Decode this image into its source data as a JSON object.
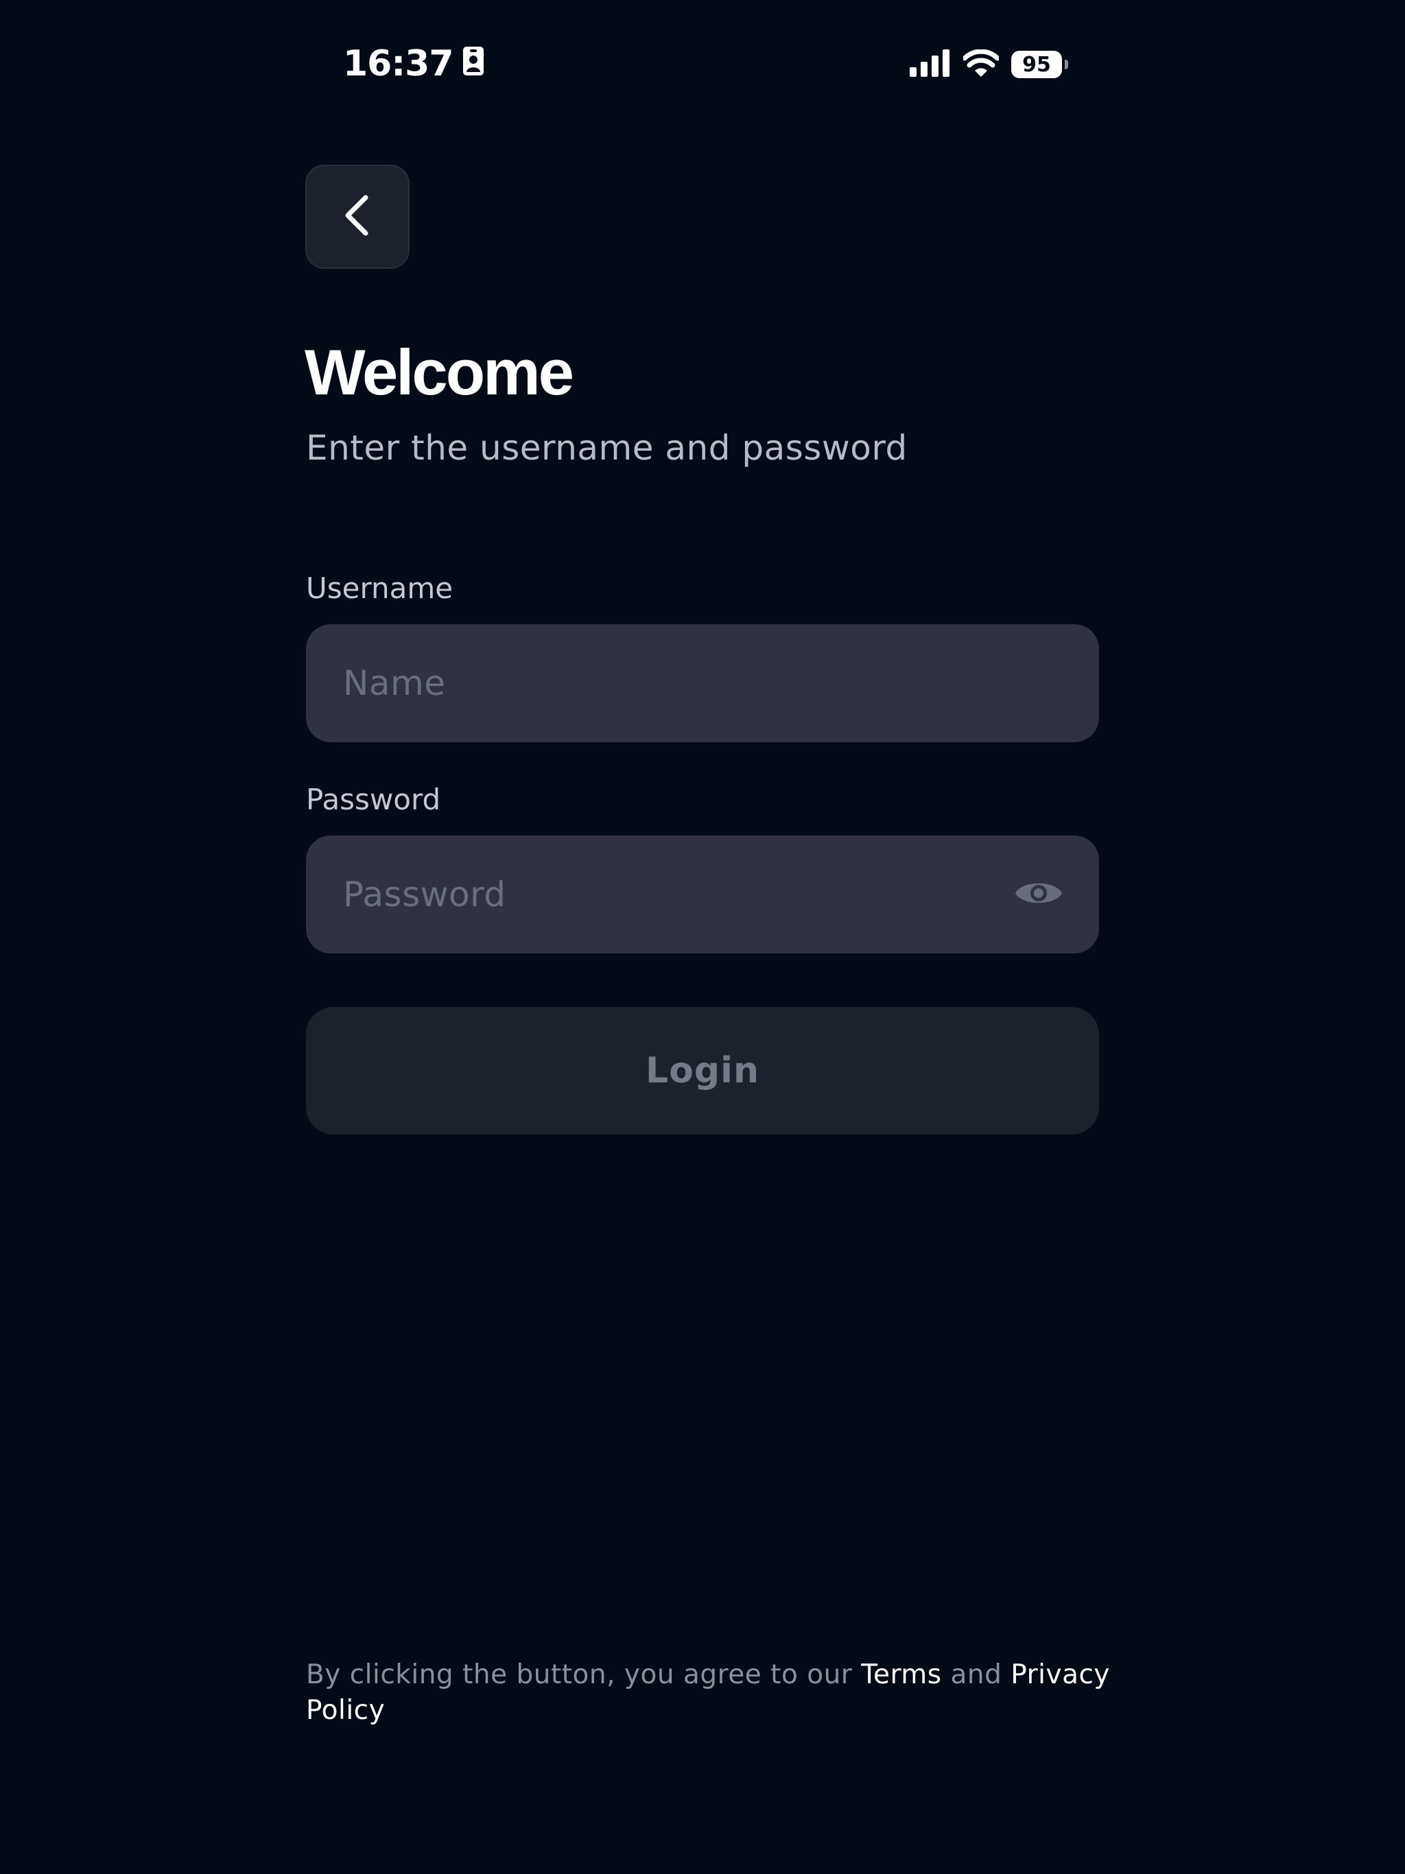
{
  "status_bar": {
    "time": "16:37",
    "battery": "95"
  },
  "header": {
    "title": "Welcome",
    "subtitle": "Enter the username and password"
  },
  "form": {
    "username_label": "Username",
    "username_placeholder": "Name",
    "username_value": "",
    "password_label": "Password",
    "password_placeholder": "Password",
    "password_value": "",
    "login_label": "Login"
  },
  "legal": {
    "prefix": "By clicking the button, you agree to our ",
    "terms": "Terms",
    "conjunction": " and ",
    "privacy": "Privacy Policy"
  },
  "icons": {
    "back": "chevron-left-icon",
    "password_toggle": "eye-icon",
    "signal": "cellular-signal-icon",
    "wifi": "wifi-icon",
    "battery": "battery-icon",
    "sim": "sim-card-icon"
  },
  "colors": {
    "background": "#050b16",
    "input_bg": "#31323f",
    "button_bg": "#1d212b",
    "text_primary": "#ffffff",
    "text_muted": "#8b8f99"
  }
}
